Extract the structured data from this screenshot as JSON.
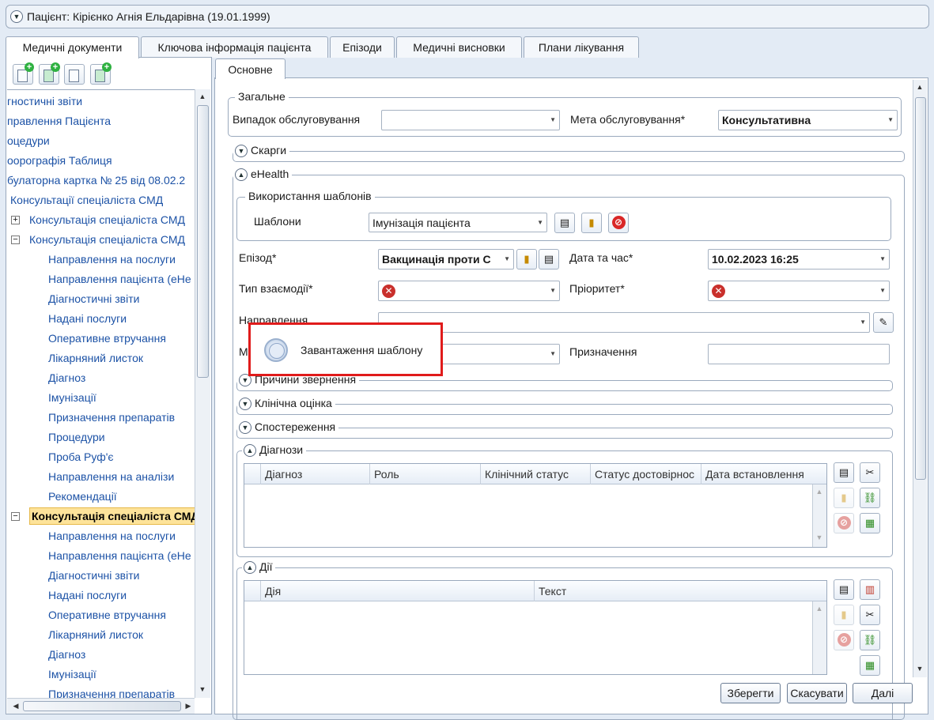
{
  "patient_header": {
    "title": "Пацієнт: Кірієнко Агнія Ельдарівна (19.01.1999)"
  },
  "main_tabs": [
    {
      "label": "Медичні документи"
    },
    {
      "label": "Ключова інформація пацієнта"
    },
    {
      "label": "Епізоди"
    },
    {
      "label": "Медичні висновки"
    },
    {
      "label": "Плани лікування"
    }
  ],
  "tree": {
    "nodes": [
      {
        "label": "гностичні звіти"
      },
      {
        "label": "правлення Пацієнта"
      },
      {
        "label": "оцедури"
      },
      {
        "label": "оорографія Таблиця"
      },
      {
        "label": "булаторна картка № 25 від 08.02.2"
      },
      {
        "label": "Консультації спеціаліста СМД"
      },
      {
        "label": "Консультація спеціаліста СМД"
      },
      {
        "label": "Консультація спеціаліста СМД"
      },
      {
        "label": "Направлення на послуги"
      },
      {
        "label": "Направлення пацієнта (eHe"
      },
      {
        "label": "Діагностичні звіти"
      },
      {
        "label": "Надані послуги"
      },
      {
        "label": "Оперативне втручання"
      },
      {
        "label": "Лікарняний листок"
      },
      {
        "label": "Діагноз"
      },
      {
        "label": "Імунізації"
      },
      {
        "label": "Призначення препаратів"
      },
      {
        "label": "Процедури"
      },
      {
        "label": "Проба Руф'є"
      },
      {
        "label": "Направлення на аналізи"
      },
      {
        "label": "Рекомендації"
      },
      {
        "label": "Консультація спеціаліста СМД"
      },
      {
        "label": "Направлення на послуги"
      },
      {
        "label": "Направлення пацієнта (eHe"
      },
      {
        "label": "Діагностичні звіти"
      },
      {
        "label": "Надані послуги"
      },
      {
        "label": "Оперативне втручання"
      },
      {
        "label": "Лікарняний листок"
      },
      {
        "label": "Діагноз"
      },
      {
        "label": "Імунізації"
      },
      {
        "label": "Призначення препаратів"
      }
    ]
  },
  "inner_tab": {
    "label": "Основне"
  },
  "general": {
    "title": "Загальне",
    "case_label": "Випадок обслуговування",
    "case_value": "",
    "purpose_label": "Мета обслуговування*",
    "purpose_value": "Консультативна"
  },
  "complaints": {
    "title": "Скарги"
  },
  "ehealth": {
    "title": "eHealth",
    "templates_group": "Використання шаблонів",
    "templates_label": "Шаблони",
    "templates_value": "Імунізація пацієнта",
    "episode_label": "Епізод*",
    "episode_value": "Вакцинація проти С",
    "datetime_label": "Дата та час*",
    "datetime_value": "10.02.2023 16:25",
    "interaction_label": "Тип взаємодії*",
    "priority_label": "Пріоритет*",
    "referral_label": "Направлення",
    "m_label": "М",
    "purpose2_label": "Призначення",
    "reasons_title": "Причини звернення",
    "clinical_title": "Клінічна оцінка",
    "observations_title": "Спостереження"
  },
  "diagnoses": {
    "title": "Діагнози",
    "columns": [
      "Діагноз",
      "Роль",
      "Клінічний статус",
      "Статус достовірнос",
      "Дата встановлення"
    ]
  },
  "actions": {
    "title": "Дії",
    "columns": [
      "Дія",
      "Текст"
    ]
  },
  "loading": {
    "text": "Завантаження шаблону"
  },
  "buttons": {
    "save": "Зберегти",
    "cancel": "Скасувати",
    "next": "Далі"
  },
  "colors": {
    "accent_red": "#e01b1b",
    "selection": "#fde39a",
    "link_blue": "#1c52a6"
  }
}
